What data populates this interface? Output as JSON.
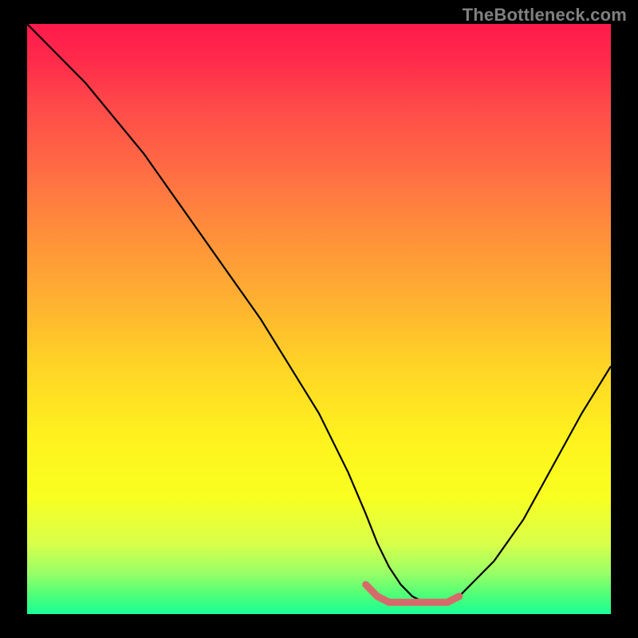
{
  "watermark": "TheBottleneck.com",
  "chart_data": {
    "type": "line",
    "title": "",
    "xlabel": "",
    "ylabel": "",
    "xlim": [
      0,
      100
    ],
    "ylim": [
      0,
      100
    ],
    "series": [
      {
        "name": "curve",
        "color": "#000000",
        "x": [
          0,
          5,
          10,
          15,
          20,
          25,
          30,
          35,
          40,
          45,
          50,
          55,
          58,
          60,
          62,
          64,
          66,
          68,
          70,
          72,
          74,
          76,
          80,
          85,
          90,
          95,
          100
        ],
        "values": [
          100,
          95,
          90,
          84,
          78,
          71,
          64,
          57,
          50,
          42,
          34,
          24,
          17,
          12,
          8,
          5,
          3,
          2,
          2,
          2,
          3,
          5,
          9,
          16,
          25,
          34,
          42
        ]
      },
      {
        "name": "highlight",
        "color": "#d66a6a",
        "x": [
          58,
          60,
          62,
          64,
          66,
          68,
          70,
          72,
          74
        ],
        "values": [
          5,
          3,
          2,
          2,
          2,
          2,
          2,
          2,
          3
        ]
      }
    ]
  }
}
